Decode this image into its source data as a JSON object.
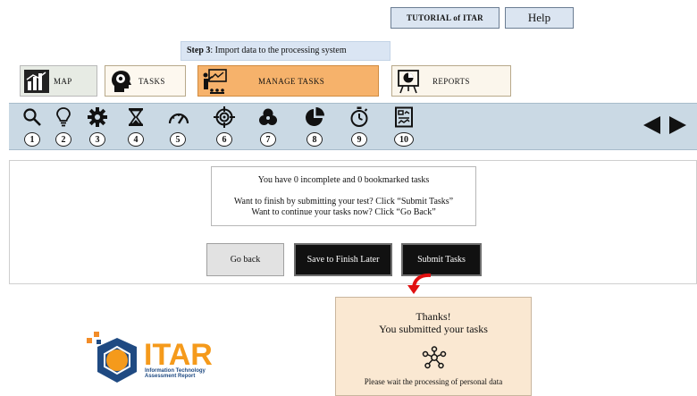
{
  "header": {
    "tutorial_label": "TUTORIAL of ITAR",
    "help_label": "Help"
  },
  "step": {
    "number_label": "Step 3",
    "text": ": Import data to the processing system"
  },
  "tabs": [
    {
      "label": "MAP",
      "icon": "bar-chart-icon"
    },
    {
      "label": "TASKS",
      "icon": "head-gear-icon"
    },
    {
      "label": "MANAGE TASKS",
      "icon": "presentation-icon"
    },
    {
      "label": "REPORTS",
      "icon": "pie-board-icon"
    }
  ],
  "toolbar": {
    "tools": [
      {
        "num": "1",
        "icon": "search-icon"
      },
      {
        "num": "2",
        "icon": "lightbulb-icon"
      },
      {
        "num": "3",
        "icon": "gear-icon"
      },
      {
        "num": "4",
        "icon": "hourglass-icon"
      },
      {
        "num": "5",
        "icon": "gauge-icon"
      },
      {
        "num": "6",
        "icon": "crosshair-icon"
      },
      {
        "num": "7",
        "icon": "circles-icon"
      },
      {
        "num": "8",
        "icon": "pie-icon"
      },
      {
        "num": "9",
        "icon": "stopwatch-icon"
      },
      {
        "num": "10",
        "icon": "report-icon"
      }
    ]
  },
  "message": {
    "line1": "You have 0 incomplete and 0 bookmarked tasks",
    "line2": "Want to finish by submitting your test? Click “Submit Tasks”",
    "line3": "Want to continue your tasks now? Click “Go Back”"
  },
  "actions": {
    "go_back": "Go back",
    "save_later": "Save to Finish Later",
    "submit": "Submit Tasks"
  },
  "thanks": {
    "title": "Thanks!",
    "subtitle": "You submitted your tasks",
    "wait": "Please wait the processing of personal data"
  },
  "logo": {
    "name": "ITAR",
    "tagline_1": "Information Technology",
    "tagline_2": "Assessment Report"
  },
  "colors": {
    "accent_orange": "#f6b26b",
    "toolbar_blue": "#cad9e4",
    "thanks_bg": "#fae8d2",
    "logo_blue": "#1f4a82"
  }
}
